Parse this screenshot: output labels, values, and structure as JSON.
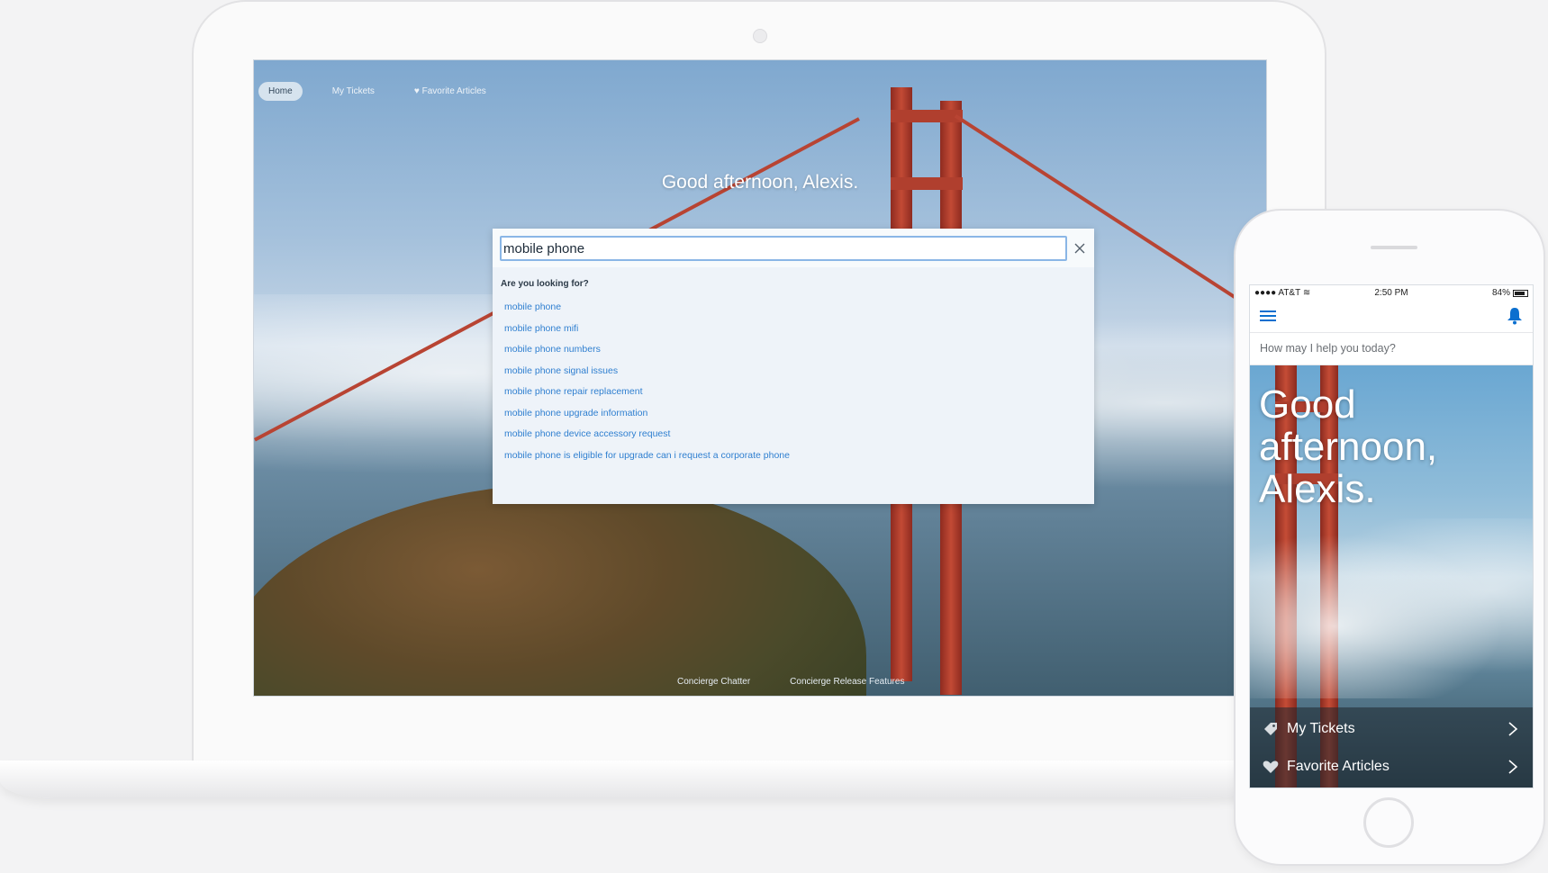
{
  "laptop": {
    "nav": {
      "home": "Home",
      "my_tickets": "My Tickets",
      "favorite_articles": "Favorite Articles"
    },
    "greeting": "Good afternoon, Alexis.",
    "search": {
      "value": "mobile phone",
      "suggest_title": "Are you looking for?",
      "suggestions": [
        "mobile phone",
        "mobile phone mifi",
        "mobile phone numbers",
        "mobile phone signal issues",
        "mobile phone repair replacement",
        "mobile phone upgrade information",
        "mobile phone device accessory request",
        "mobile phone is eligible for upgrade can i request a corporate phone"
      ]
    },
    "footer": {
      "link1": "Concierge Chatter",
      "link2": "Concierge Release Features"
    },
    "colors": {
      "link": "#2f7fd0",
      "input_border": "#8ab6e6"
    }
  },
  "phone": {
    "status": {
      "carrier": "●●●● AT&T",
      "time": "2:50 PM",
      "battery": "84%"
    },
    "search_placeholder": "How may I help you today?",
    "greeting": "Good afternoon, Alexis.",
    "links": {
      "my_tickets": "My Tickets",
      "favorite_articles": "Favorite Articles"
    },
    "colors": {
      "accent": "#0b6fcf"
    }
  }
}
